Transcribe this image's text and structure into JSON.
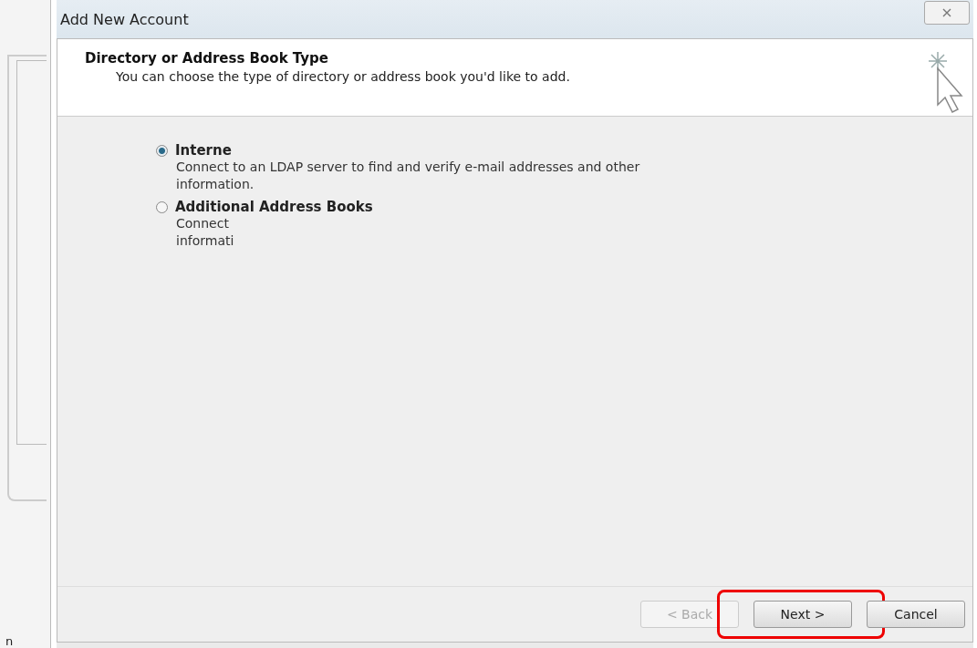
{
  "window": {
    "title": "Add New Account"
  },
  "header": {
    "title": "Directory or Address Book Type",
    "subtitle": "You can choose the type of directory or address book you'd like to add."
  },
  "options": [
    {
      "label": "Interne",
      "description": "Connect to an LDAP server to find and verify e-mail addresses and other information.",
      "selected": true
    },
    {
      "label": "Additional Address Books",
      "description": "Connect",
      "description_2": "informati",
      "selected": false
    }
  ],
  "buttons": [
    {
      "label": "< Back",
      "disabled": true,
      "highlighted": false
    },
    {
      "label": "Next >",
      "disabled": false,
      "highlighted": true
    },
    {
      "label": "Cancel",
      "disabled": false,
      "highlighted": false
    }
  ],
  "background_window": {
    "fragment": "n"
  }
}
